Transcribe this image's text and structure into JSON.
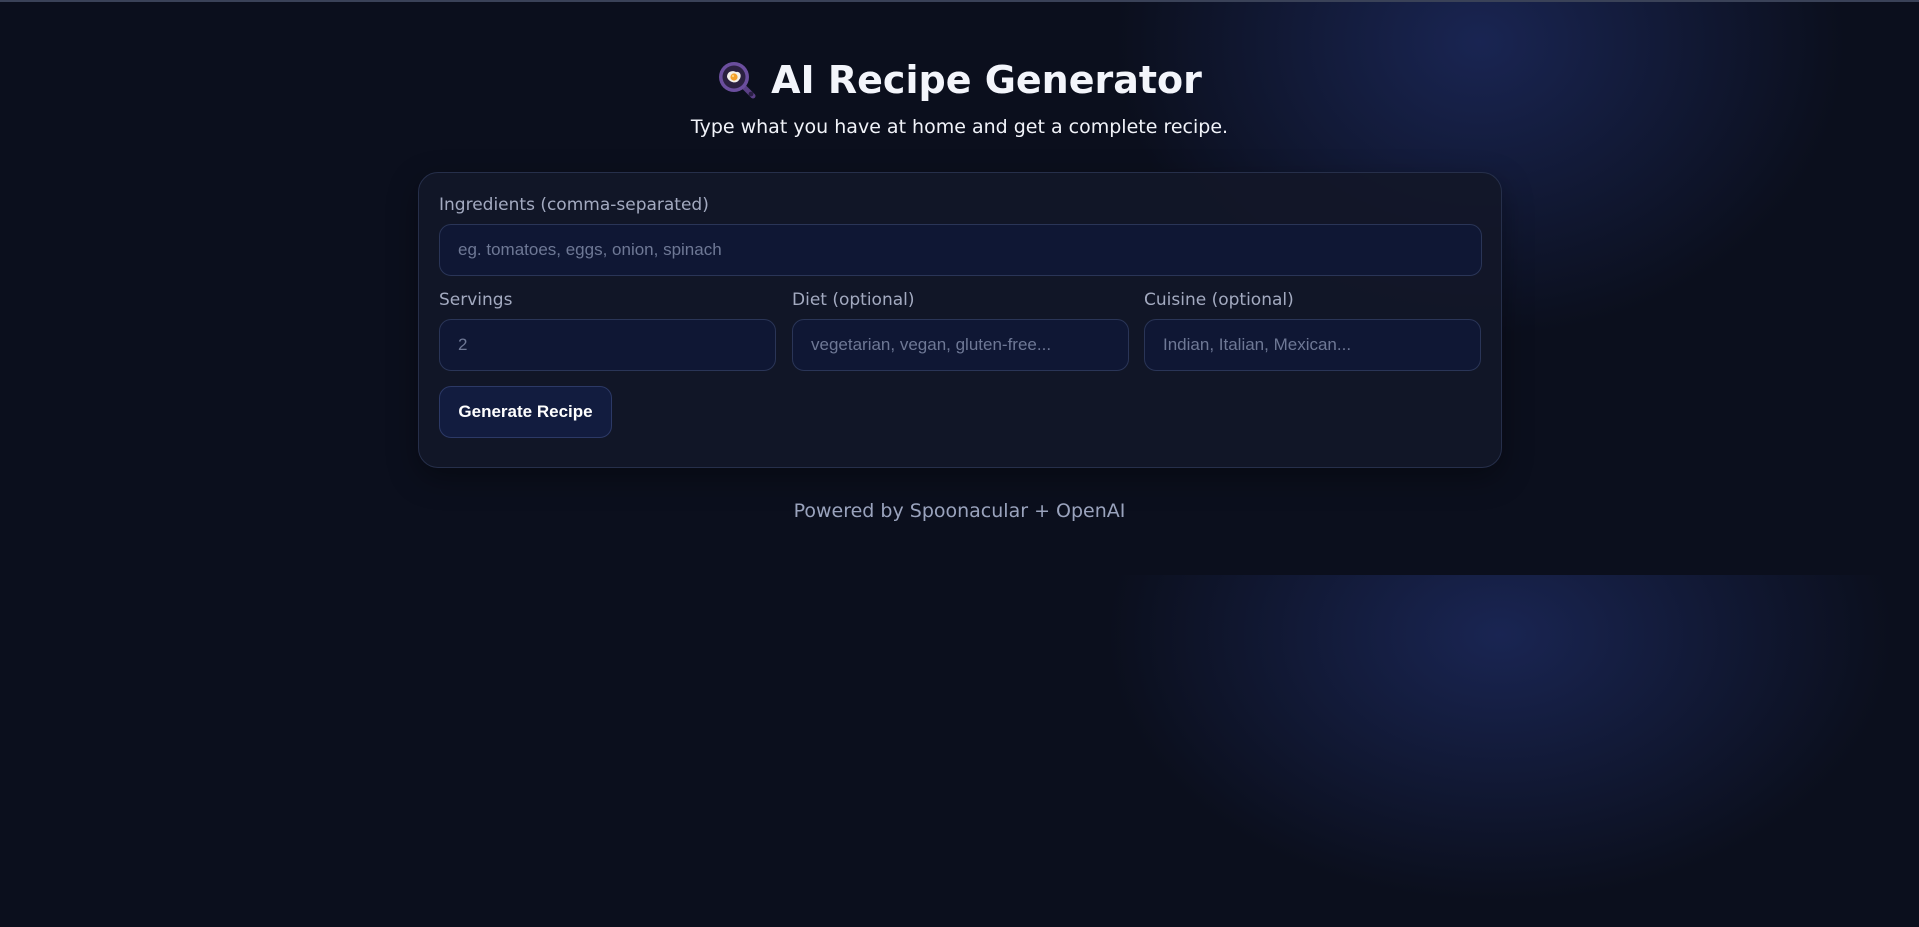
{
  "header": {
    "title": "AI Recipe Generator",
    "subtitle": "Type what you have at home and get a complete recipe.",
    "icon": "frying-pan-egg-icon"
  },
  "form": {
    "ingredients": {
      "label": "Ingredients (comma-separated)",
      "placeholder": "eg. tomatoes, eggs, onion, spinach",
      "value": ""
    },
    "servings": {
      "label": "Servings",
      "placeholder": "2",
      "value": ""
    },
    "diet": {
      "label": "Diet (optional)",
      "placeholder": "vegetarian, vegan, gluten-free...",
      "value": ""
    },
    "cuisine": {
      "label": "Cuisine (optional)",
      "placeholder": "Indian, Italian, Mexican...",
      "value": ""
    },
    "submit_label": "Generate Recipe"
  },
  "footer": {
    "text": "Powered by Spoonacular + OpenAI"
  },
  "colors": {
    "background": "#0b0f1d",
    "card": "#121728",
    "input": "#0f1734",
    "button": "#121c3f",
    "pan_purple": "#6b4e9e"
  }
}
